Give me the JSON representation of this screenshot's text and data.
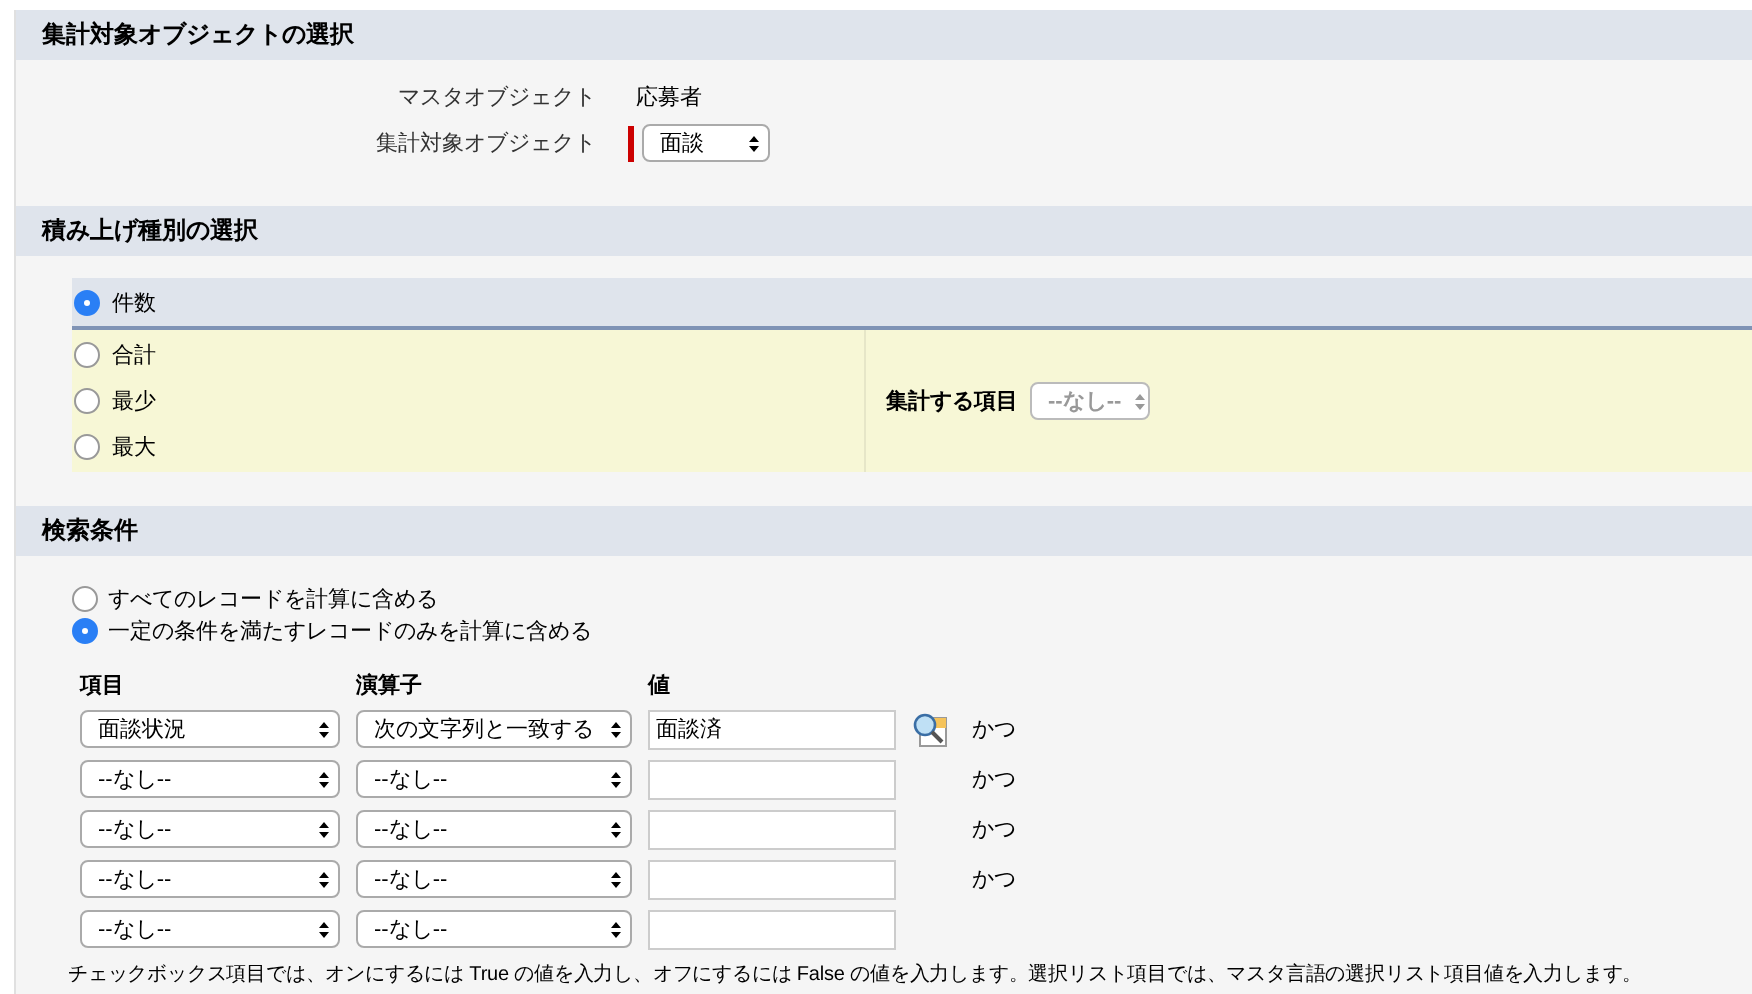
{
  "object_section": {
    "title": "集計対象オブジェクトの選択",
    "fields": [
      {
        "label": "マスタオブジェクト",
        "kind": "text",
        "value": "応募者"
      },
      {
        "label": "集計対象オブジェクト",
        "kind": "select",
        "value": "面談",
        "required": true
      }
    ]
  },
  "rollup_section": {
    "title": "積み上げ種別の選択",
    "options": [
      {
        "label": "件数",
        "selected": true
      },
      {
        "label": "合計",
        "selected": false
      },
      {
        "label": "最少",
        "selected": false
      },
      {
        "label": "最大",
        "selected": false
      }
    ],
    "field_label": "集計する項目",
    "field_select": {
      "value": "--なし--",
      "disabled": true
    }
  },
  "filter_section": {
    "title": "検索条件",
    "modes": [
      {
        "label": "すべてのレコードを計算に含める",
        "selected": false
      },
      {
        "label": "一定の条件を満たすレコードのみを計算に含める",
        "selected": true
      }
    ],
    "columns": [
      "項目",
      "演算子",
      "値"
    ],
    "rows": [
      {
        "field": "面談状況",
        "operator": "次の文字列と一致する",
        "value": "面談済",
        "lookup": true,
        "conjunction": "かつ"
      },
      {
        "field": "--なし--",
        "operator": "--なし--",
        "value": "",
        "lookup": false,
        "conjunction": "かつ"
      },
      {
        "field": "--なし--",
        "operator": "--なし--",
        "value": "",
        "lookup": false,
        "conjunction": "かつ"
      },
      {
        "field": "--なし--",
        "operator": "--なし--",
        "value": "",
        "lookup": false,
        "conjunction": "かつ"
      },
      {
        "field": "--なし--",
        "operator": "--なし--",
        "value": "",
        "lookup": false
      }
    ],
    "note": "チェックボックス項目では、オンにするには True の値を入力し、オフにするには False の値を入力します。選択リスト項目では、マスタ言語の選択リスト項目値を入力します。"
  }
}
